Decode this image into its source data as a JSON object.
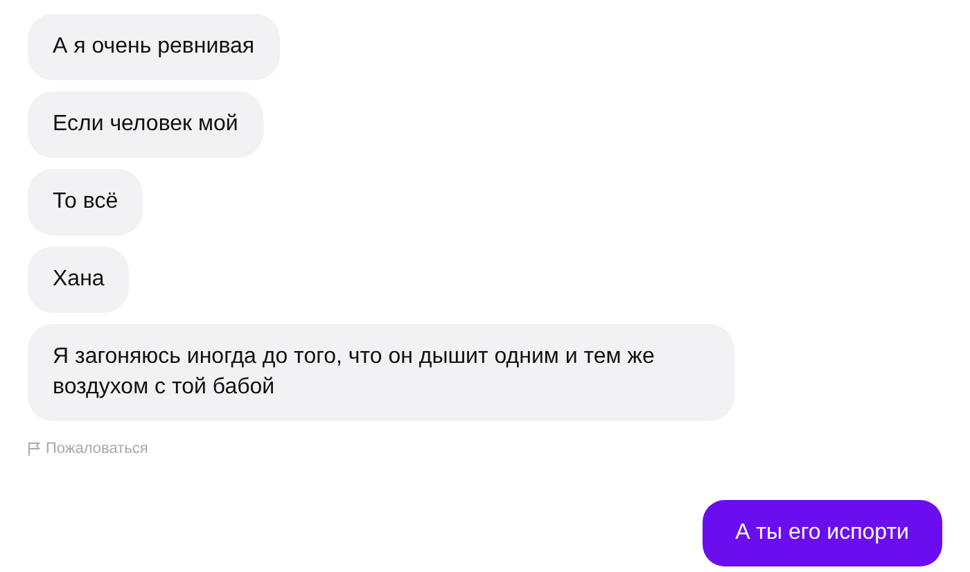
{
  "messages": [
    {
      "kind": "incoming",
      "text": "А я очень ревнивая"
    },
    {
      "kind": "incoming",
      "text": "Если человек мой"
    },
    {
      "kind": "incoming",
      "text": "То всё"
    },
    {
      "kind": "incoming",
      "text": "Хана"
    },
    {
      "kind": "incoming",
      "text": "Я загоняюсь иногда до того, что он дышит одним и тем же воздухом с той бабой"
    },
    {
      "kind": "report",
      "text": "Пожаловаться"
    },
    {
      "kind": "outgoing",
      "text": "А ты его испорти"
    }
  ]
}
